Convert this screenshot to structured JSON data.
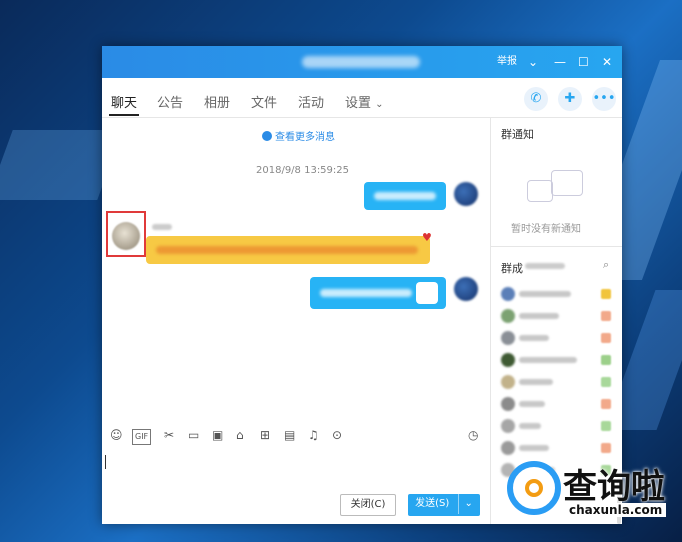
{
  "window": {
    "titlebar": {
      "report_label": "举报"
    },
    "tabs": [
      {
        "label": "聊天",
        "active": true
      },
      {
        "label": "公告"
      },
      {
        "label": "相册"
      },
      {
        "label": "文件"
      },
      {
        "label": "活动"
      },
      {
        "label": "设置"
      }
    ],
    "accent_color": "#27a6f0"
  },
  "chat": {
    "more_messages_label": "查看更多消息",
    "timestamp": "2018/9/8 13:59:25"
  },
  "composer": {
    "toolbar_icons": [
      "emoji-icon",
      "gif-icon",
      "scissors-icon",
      "folder-icon",
      "image-icon",
      "shopping-icon",
      "gift-icon",
      "calendar-icon",
      "bell-icon",
      "more-icon",
      "history-icon"
    ],
    "gif_label": "GIF",
    "close_label": "关闭(C)",
    "send_label": "发送(S)"
  },
  "sidebar": {
    "notice_title": "群通知",
    "notice_empty": "暂时没有新通知",
    "members_title": "群成"
  },
  "watermark": {
    "cn": "查询啦",
    "url": "chaxunla.com"
  }
}
